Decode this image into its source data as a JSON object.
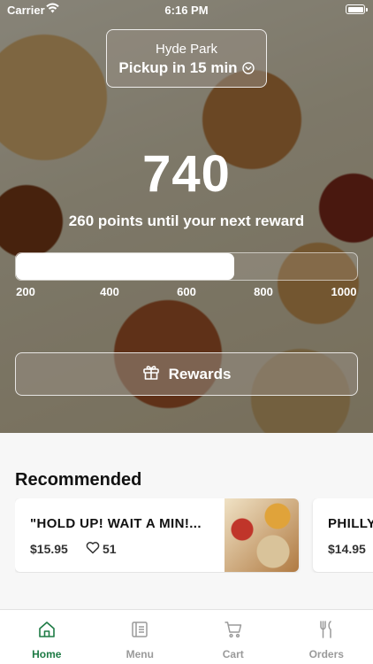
{
  "status_bar": {
    "carrier": "Carrier",
    "time": "6:16 PM"
  },
  "location": {
    "name": "Hyde Park",
    "pickup": "Pickup in 15 min"
  },
  "rewards": {
    "points": "740",
    "until_text": "260 points until your next reward",
    "progress_fraction": 0.64,
    "ticks": [
      "200",
      "400",
      "600",
      "800",
      "1000"
    ],
    "button_label": "Rewards"
  },
  "recommended": {
    "title": "Recommended",
    "items": [
      {
        "name": "\"HOLD UP! WAIT A MIN!...",
        "price": "$15.95",
        "likes": "51"
      },
      {
        "name": "PHILLY",
        "price": "$14.95"
      }
    ]
  },
  "tabbar": {
    "tabs": [
      {
        "label": "Home",
        "icon": "home-icon",
        "active": true
      },
      {
        "label": "Menu",
        "icon": "menu-icon",
        "active": false
      },
      {
        "label": "Cart",
        "icon": "cart-icon",
        "active": false
      },
      {
        "label": "Orders",
        "icon": "fork-knife-icon",
        "active": false
      }
    ]
  },
  "colors": {
    "accent": "#1e7b45",
    "inactive": "#9a9a9a"
  }
}
